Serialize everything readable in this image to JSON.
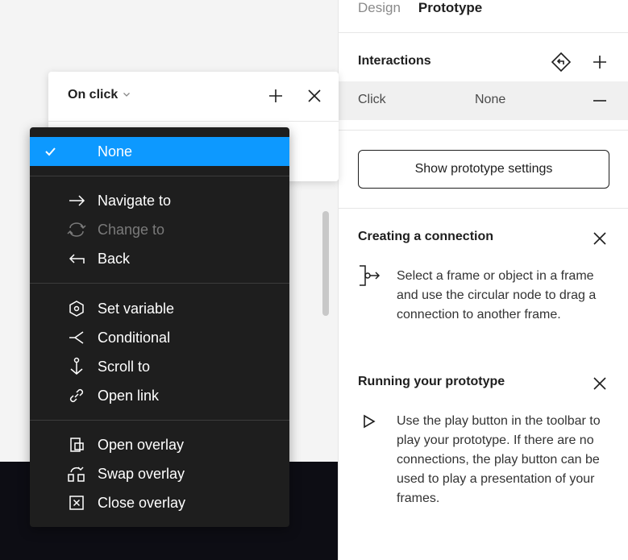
{
  "tabs": [
    {
      "label": "Design",
      "active": false
    },
    {
      "label": "Prototype",
      "active": true
    }
  ],
  "interactions": {
    "title": "Interactions",
    "row": {
      "trigger": "Click",
      "action": "None"
    }
  },
  "settings_button_label": "Show prototype settings",
  "help": [
    {
      "title": "Creating a connection",
      "text": "Select a frame or object in a frame and use the circular node to drag a connection to another frame.",
      "icon": "connection-node-icon"
    },
    {
      "title": "Running your prototype",
      "text": "Use the play button in the toolbar to play your prototype. If there are no connections, the play button can be used to play a presentation of your frames.",
      "icon": "play-icon"
    }
  ],
  "popover": {
    "trigger_label": "On click"
  },
  "menu": {
    "groups": [
      [
        {
          "label": "None",
          "icon": "check-icon",
          "selected": true
        }
      ],
      [
        {
          "label": "Navigate to",
          "icon": "arrow-right-icon"
        },
        {
          "label": "Change to",
          "icon": "change-icon",
          "disabled": true
        },
        {
          "label": "Back",
          "icon": "back-arrow-icon"
        }
      ],
      [
        {
          "label": "Set variable",
          "icon": "hexagon-icon"
        },
        {
          "label": "Conditional",
          "icon": "conditional-icon"
        },
        {
          "label": "Scroll to",
          "icon": "anchor-icon"
        },
        {
          "label": "Open link",
          "icon": "link-icon"
        }
      ],
      [
        {
          "label": "Open overlay",
          "icon": "open-overlay-icon"
        },
        {
          "label": "Swap overlay",
          "icon": "swap-overlay-icon"
        },
        {
          "label": "Close overlay",
          "icon": "close-overlay-icon"
        }
      ]
    ]
  },
  "colors": {
    "accent": "#0d99ff",
    "menu_bg": "#1e1e1e",
    "canvas_dark": "#0d0d14"
  }
}
